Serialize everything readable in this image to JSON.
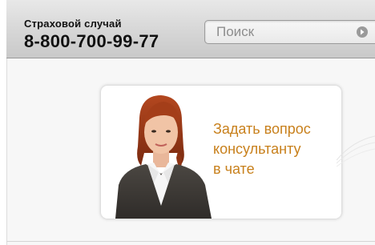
{
  "header": {
    "label": "Страховой случай",
    "phone": "8-800-700-99-77"
  },
  "search": {
    "placeholder": "Поиск",
    "value": ""
  },
  "banner": {
    "lines": [
      "Задать вопрос",
      "консультанту",
      "в чате"
    ]
  },
  "colors": {
    "accent": "#c8801c",
    "header_bg": "#d6d6d6"
  }
}
